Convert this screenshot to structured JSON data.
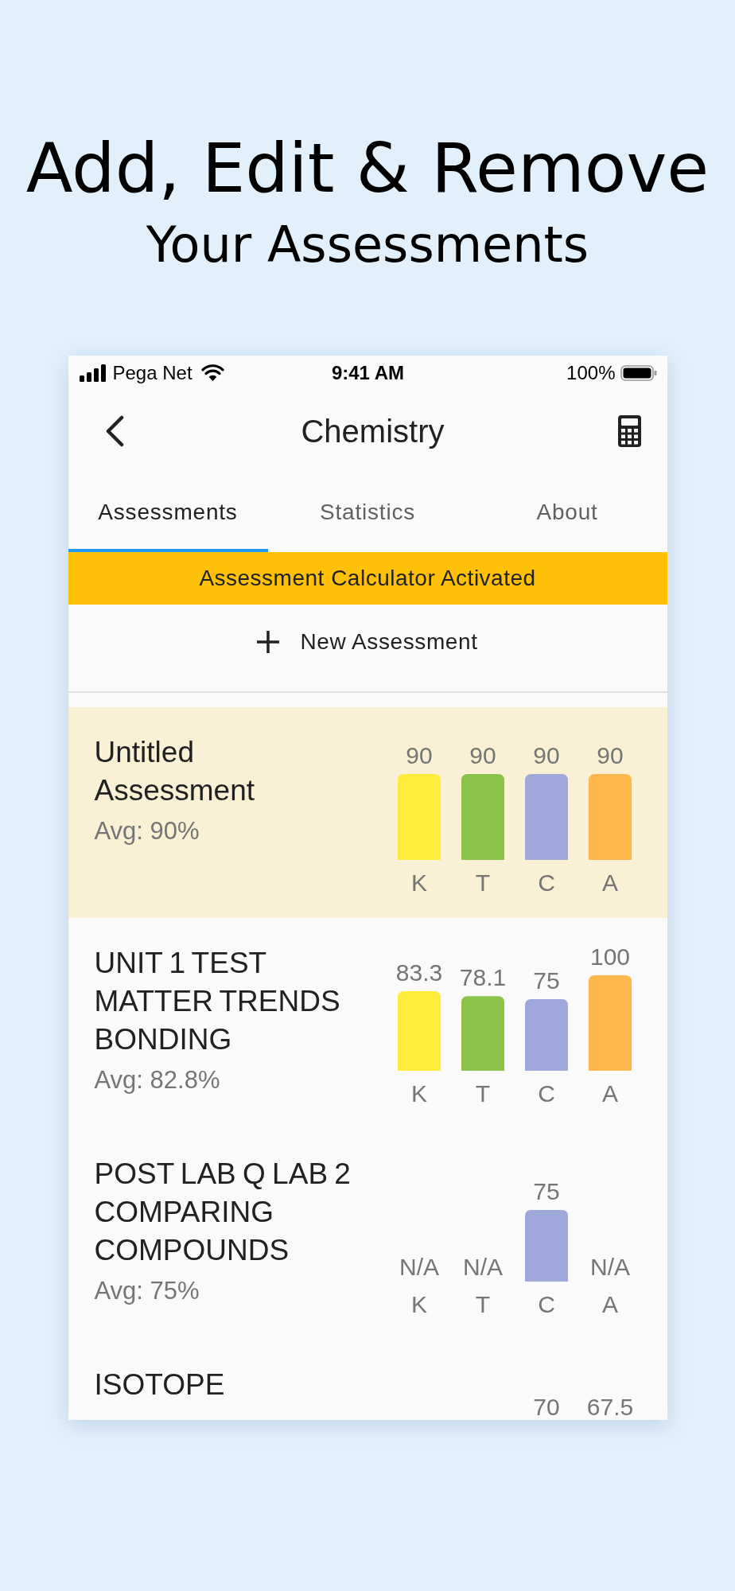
{
  "headline": {
    "title": "Add, Edit & Remove",
    "subtitle": "Your Assessments"
  },
  "status_bar": {
    "carrier": "Pega Net",
    "time": "9:41 AM",
    "battery": "100%"
  },
  "app_bar": {
    "title": "Chemistry"
  },
  "tabs": [
    {
      "label": "Assessments",
      "selected": true
    },
    {
      "label": "Statistics",
      "selected": false
    },
    {
      "label": "About",
      "selected": false
    }
  ],
  "banner": {
    "text": "Assessment Calculator Activated"
  },
  "new_assessment_button": {
    "label": "New Assessment"
  },
  "assessments": [
    {
      "title": "Untitled Assessment",
      "average": "Avg: 90%",
      "selected": true,
      "chart_data": {
        "type": "bar",
        "categories": [
          "K",
          "T",
          "C",
          "A"
        ],
        "values": [
          90,
          90,
          90,
          90
        ],
        "value_labels": [
          "90",
          "90",
          "90",
          "90"
        ],
        "colors": [
          "#ffeb3b",
          "#8bc34a",
          "#9fa8da",
          "#ffb74d"
        ]
      }
    },
    {
      "title": "UNIT 1 TEST MATTER TRENDS BONDING",
      "average": "Avg: 82.8%",
      "selected": false,
      "chart_data": {
        "type": "bar",
        "categories": [
          "K",
          "T",
          "C",
          "A"
        ],
        "values": [
          83.3,
          78.1,
          75,
          100
        ],
        "value_labels": [
          "83.3",
          "78.1",
          "75",
          "100"
        ],
        "colors": [
          "#ffeb3b",
          "#8bc34a",
          "#9fa8da",
          "#ffb74d"
        ]
      }
    },
    {
      "title": "POST LAB Q LAB 2 COMPARING COMPOUNDS",
      "average": "Avg: 75%",
      "selected": false,
      "chart_data": {
        "type": "bar",
        "categories": [
          "K",
          "T",
          "C",
          "A"
        ],
        "values": [
          null,
          null,
          75,
          null
        ],
        "value_labels": [
          "N/A",
          "N/A",
          "75",
          "N/A"
        ],
        "colors": [
          null,
          null,
          "#9fa8da",
          null
        ]
      }
    },
    {
      "title": "ISOTOPE",
      "selected": false,
      "score_column_3": "70",
      "score_column_4": "67.5"
    }
  ]
}
